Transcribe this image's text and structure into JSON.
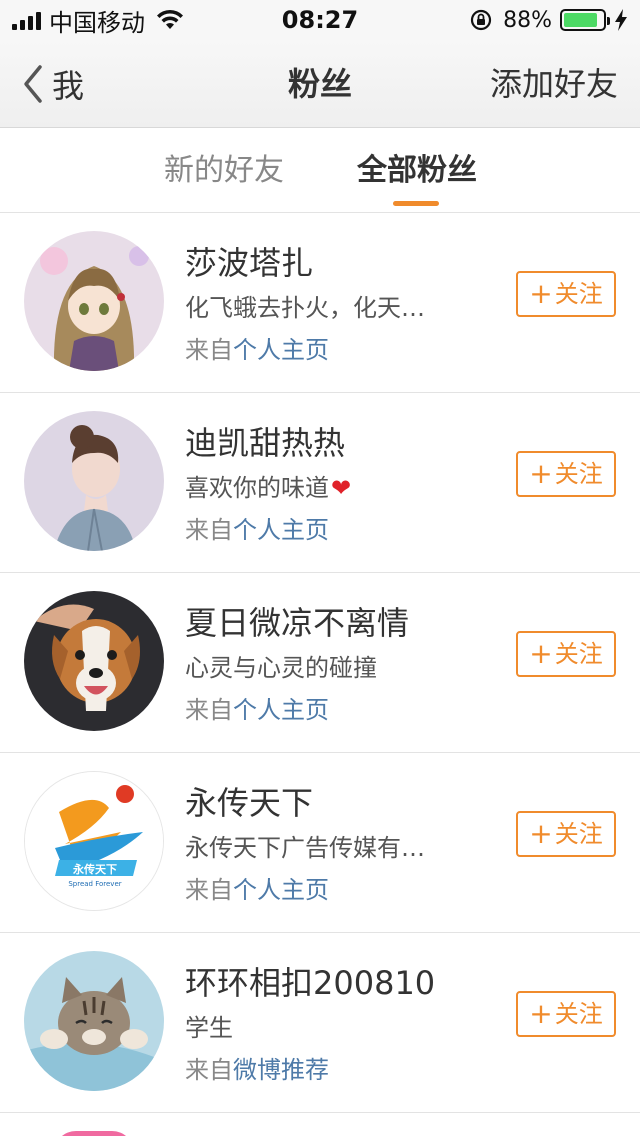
{
  "status_bar": {
    "carrier": "中国移动",
    "time": "08:27",
    "battery_percent": "88%",
    "battery_level": 0.88,
    "icons": [
      "signal-icon",
      "wifi-icon",
      "rotation-lock-icon",
      "battery-icon",
      "charging-bolt-icon"
    ]
  },
  "nav": {
    "back_label": "我",
    "title": "粉丝",
    "right_action": "添加好友"
  },
  "tabs": [
    {
      "label": "新的好友",
      "selected": false
    },
    {
      "label": "全部粉丝",
      "selected": true
    }
  ],
  "colors": {
    "accent": "#f08b2c",
    "link": "#4e7aa8",
    "battery": "#4cd964"
  },
  "fans": [
    {
      "name": "莎波塔扎",
      "description": "化飞蛾去扑火，化天…",
      "source_prefix": "来自",
      "source": "个人主页",
      "follow_label": "关注"
    },
    {
      "name": "迪凯甜热热",
      "description": "喜欢你的味道",
      "description_emoji": "❤",
      "source_prefix": "来自",
      "source": "个人主页",
      "follow_label": "关注"
    },
    {
      "name": "夏日微凉不离情",
      "description": "心灵与心灵的碰撞",
      "source_prefix": "来自",
      "source": "个人主页",
      "follow_label": "关注"
    },
    {
      "name": "永传天下",
      "description": "永传天下广告传媒有…",
      "source_prefix": "来自",
      "source": "个人主页",
      "follow_label": "关注"
    },
    {
      "name": "环环相扣200810",
      "description": "学生",
      "source_prefix": "来自",
      "source": "微博推荐",
      "follow_label": "关注"
    }
  ]
}
